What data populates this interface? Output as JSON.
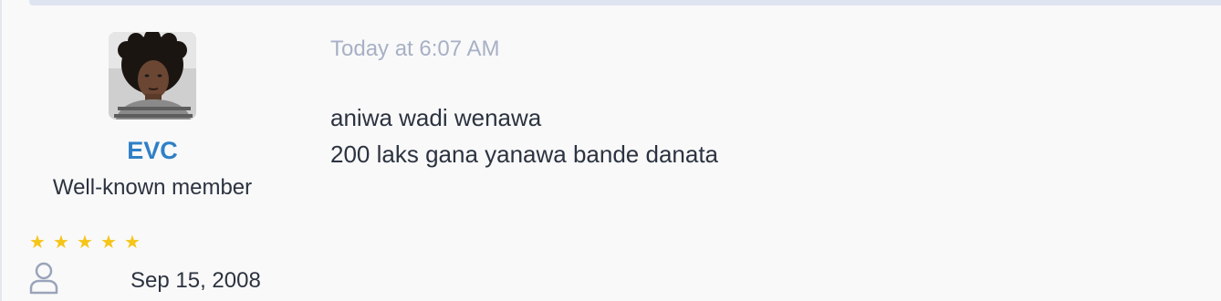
{
  "post": {
    "timestamp": "Today at 6:07 AM",
    "lines": [
      "aniwa wadi wenawa",
      "200 laks gana yanawa bande danata"
    ]
  },
  "author": {
    "name": "EVC",
    "title": "Well-known member",
    "rating_stars": 5,
    "joined": "Sep 15, 2008",
    "joined_icon": "user-icon",
    "star_icon": "star-icon"
  },
  "colors": {
    "username": "#2f7fc7",
    "timestamp": "#a7b0c5",
    "star": "#f5c518",
    "text": "#2c3340",
    "background": "#f9f9f9"
  }
}
